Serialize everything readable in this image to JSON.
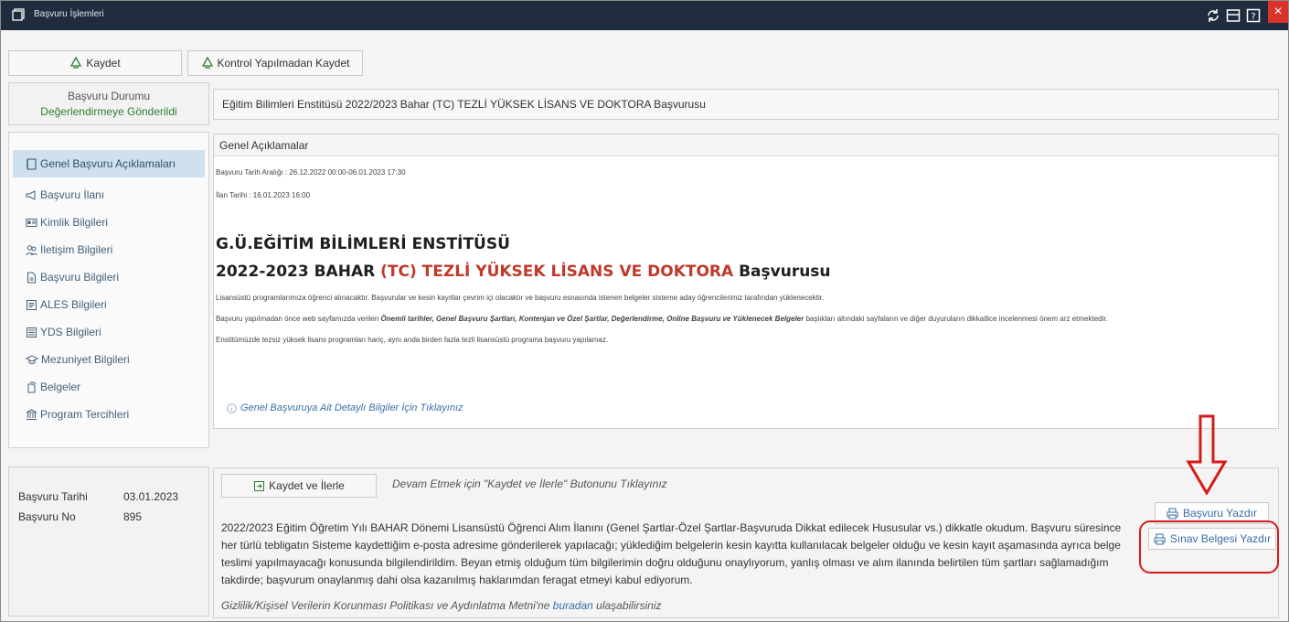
{
  "window": {
    "title": "Başvuru İşlemleri",
    "close_label": "×"
  },
  "toolbar": {
    "save_label": "Kaydet",
    "save_nocheck_label": "Kontrol Yapılmadan Kaydet"
  },
  "status": {
    "title": "Başvuru Durumu",
    "value": "Değerlendirmeye Gönderildi",
    "value_color": "#2e7d32"
  },
  "nav": {
    "items": [
      {
        "label": "Genel Başvuru Açıklamaları",
        "icon": "notebook-icon",
        "active": true
      },
      {
        "label": "Başvuru İlanı",
        "icon": "megaphone-icon"
      },
      {
        "label": "Kimlik Bilgileri",
        "icon": "id-card-icon"
      },
      {
        "label": "İletişim Bilgileri",
        "icon": "contacts-icon"
      },
      {
        "label": "Başvuru Bilgileri",
        "icon": "document-icon"
      },
      {
        "label": "ALES Bilgileri",
        "icon": "form-icon"
      },
      {
        "label": "YDS Bilgileri",
        "icon": "list-icon"
      },
      {
        "label": "Mezuniyet Bilgileri",
        "icon": "graduation-cap-icon"
      },
      {
        "label": "Belgeler",
        "icon": "files-icon"
      },
      {
        "label": "Program Tercihleri",
        "icon": "institution-icon"
      }
    ]
  },
  "info": {
    "date_label": "Başvuru Tarihi",
    "date_value": "03.01.2023",
    "no_label": "Başvuru No",
    "no_value": "895"
  },
  "content": {
    "title": "Eğitim Bilimleri Enstitüsü 2022/2023 Bahar (TC) TEZLİ YÜKSEK LİSANS VE DOKTORA Başvurusu",
    "desc_header": "Genel Açıklamalar",
    "date_range": "Başvuru Tarih Aralığı : 26.12.2022 00:00-06.01.2023 17:30",
    "announce_date": "İlan Tarihi : 16.01.2023 16:00",
    "heading1": "G.Ü.EĞİTİM BİLİMLERİ ENSTİTÜSÜ",
    "heading2_a": "2022-2023 BAHAR ",
    "heading2_b": "(TC) TEZLİ YÜKSEK LİSANS VE DOKTORA",
    "heading2_c": " Başvurusu",
    "line1": "Lisansüstü programlarımıza öğrenci alınacaktır. Başvurular ve kesin kayıtlar çevrim içi olacaktır ve başvuru esnasında istenen belgeler sisteme aday öğrencilerimiz tarafından yüklenecektir.",
    "line2_a": "Başvuru yapılmadan önce web sayfamızda verilen ",
    "line2_b": "Önemli tarihler, Genel Başvuru Şartları, Kontenjan ve Özel Şartlar, Değerlendirme, Online Başvuru ve Yüklenecek Belgeler",
    "line2_c": " başlıkları altındaki sayfaların ve diğer duyuruların dikkatlice incelenmesi önem arz etmektedir.",
    "line3": "Enstitümüzde tezsiz yüksek lisans programları hariç, aynı anda birden fazla tezli lisansüstü programa başvuru yapılamaz.",
    "detail_link": "Genel Başvuruya Ait Detaylı Bilgiler İçin Tıklayınız"
  },
  "bottom": {
    "save_next_label": "Kaydet ve İlerle",
    "hint": "Devam Etmek için \"Kaydet ve İlerle\" Butonunu Tıklayınız",
    "paragraph": "2022/2023 Eğitim Öğretim Yılı BAHAR Dönemi Lisansüstü Öğrenci Alım İlanını (Genel Şartlar-Özel Şartlar-Başvuruda Dikkat edilecek Hususular vs.) dikkatle okudum. Başvuru süresince her türlü tebligatın Sisteme kaydettiğim e-posta adresime gönderilerek yapılacağı; yüklediğim belgelerin kesin kayıtta kullanılacak belgeler olduğu ve kesin kayıt aşamasında ayrıca belge teslimi yapılmayacağı konusunda bilgilendirildim. Beyan etmiş olduğum tüm bilgilerimin doğru olduğunu onaylıyorum, yanlış olması ve alım ilanında belirtilen tüm şartları sağlamadığım takdirde; başvurum onaylanmış dahi olsa kazanılmış haklarımdan feragat etmeyi kabul ediyorum.",
    "privacy_a": "Gizlilik/Kişisel Verilerin Korunması Politikası ve Aydınlatma Metni'ne ",
    "privacy_link": "buradan",
    "privacy_b": " ulaşabilirsiniz",
    "print_app_label": "Başvuru Yazdır",
    "print_exam_label": "Sınav Belgesi Yazdır"
  },
  "colors": {
    "titlebar": "#1e2c3d",
    "accent_red": "#d61a1a",
    "link_blue": "#3b6ea8",
    "nav_active": "#cfe1ec"
  }
}
